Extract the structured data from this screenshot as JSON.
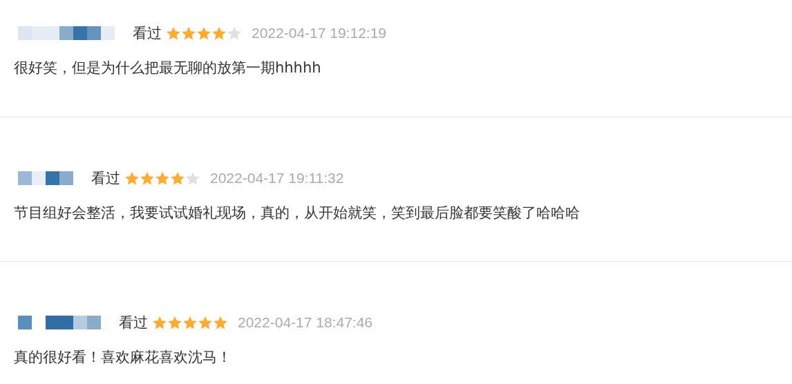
{
  "comments": [
    {
      "status": "看过",
      "stars": 4,
      "time": "2022-04-17 19:12:19",
      "text": "很好笑，但是为什么把最无聊的放第一期hhhhh"
    },
    {
      "status": "看过",
      "stars": 4,
      "time": "2022-04-17 19:11:32",
      "text": "节目组好会整活，我要试试婚礼现场，真的，从开始就笑，笑到最后脸都要笑酸了哈哈哈"
    },
    {
      "status": "看过",
      "stars": 5,
      "time": "2022-04-17 18:47:46",
      "text": "真的很好看！喜欢麻花喜欢沈马！"
    }
  ]
}
